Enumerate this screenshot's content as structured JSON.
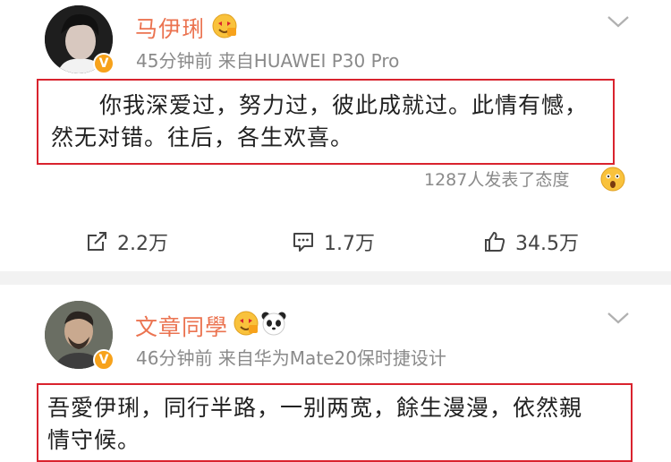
{
  "posts": [
    {
      "username": "马伊琍",
      "meta": "45分钟前   来自HUAWEI P30 Pro",
      "text_line1": "你我深爱过，努力过，彼此成就过。此情有憾，",
      "text_line2": "然无对错。往后，各生欢喜。",
      "reactions": "1287人发表了态度",
      "actions": {
        "repost": "2.2万",
        "comment": "1.7万",
        "like": "34.5万"
      }
    },
    {
      "username": "文章同學",
      "meta": "46分钟前   来自华为Mate20保时捷设计",
      "text_line1": "吾愛伊琍，同行半路，一别两宽，餘生漫漫，依然親",
      "text_line2": "情守候。"
    }
  ],
  "icons": {
    "verified": "verified-badge-icon",
    "more": "chevron-down-icon",
    "repost": "repost-icon",
    "comment": "comment-icon",
    "like": "like-icon",
    "emoji_member": "member-emoji-icon",
    "emoji_panda": "panda-icon",
    "emoji_reaction": "surprised-emoji-icon"
  },
  "colors": {
    "username": "#eb7350",
    "highlight_border": "#d9232e",
    "meta_text": "#8a8a8a",
    "verified": "#f7a21b"
  }
}
